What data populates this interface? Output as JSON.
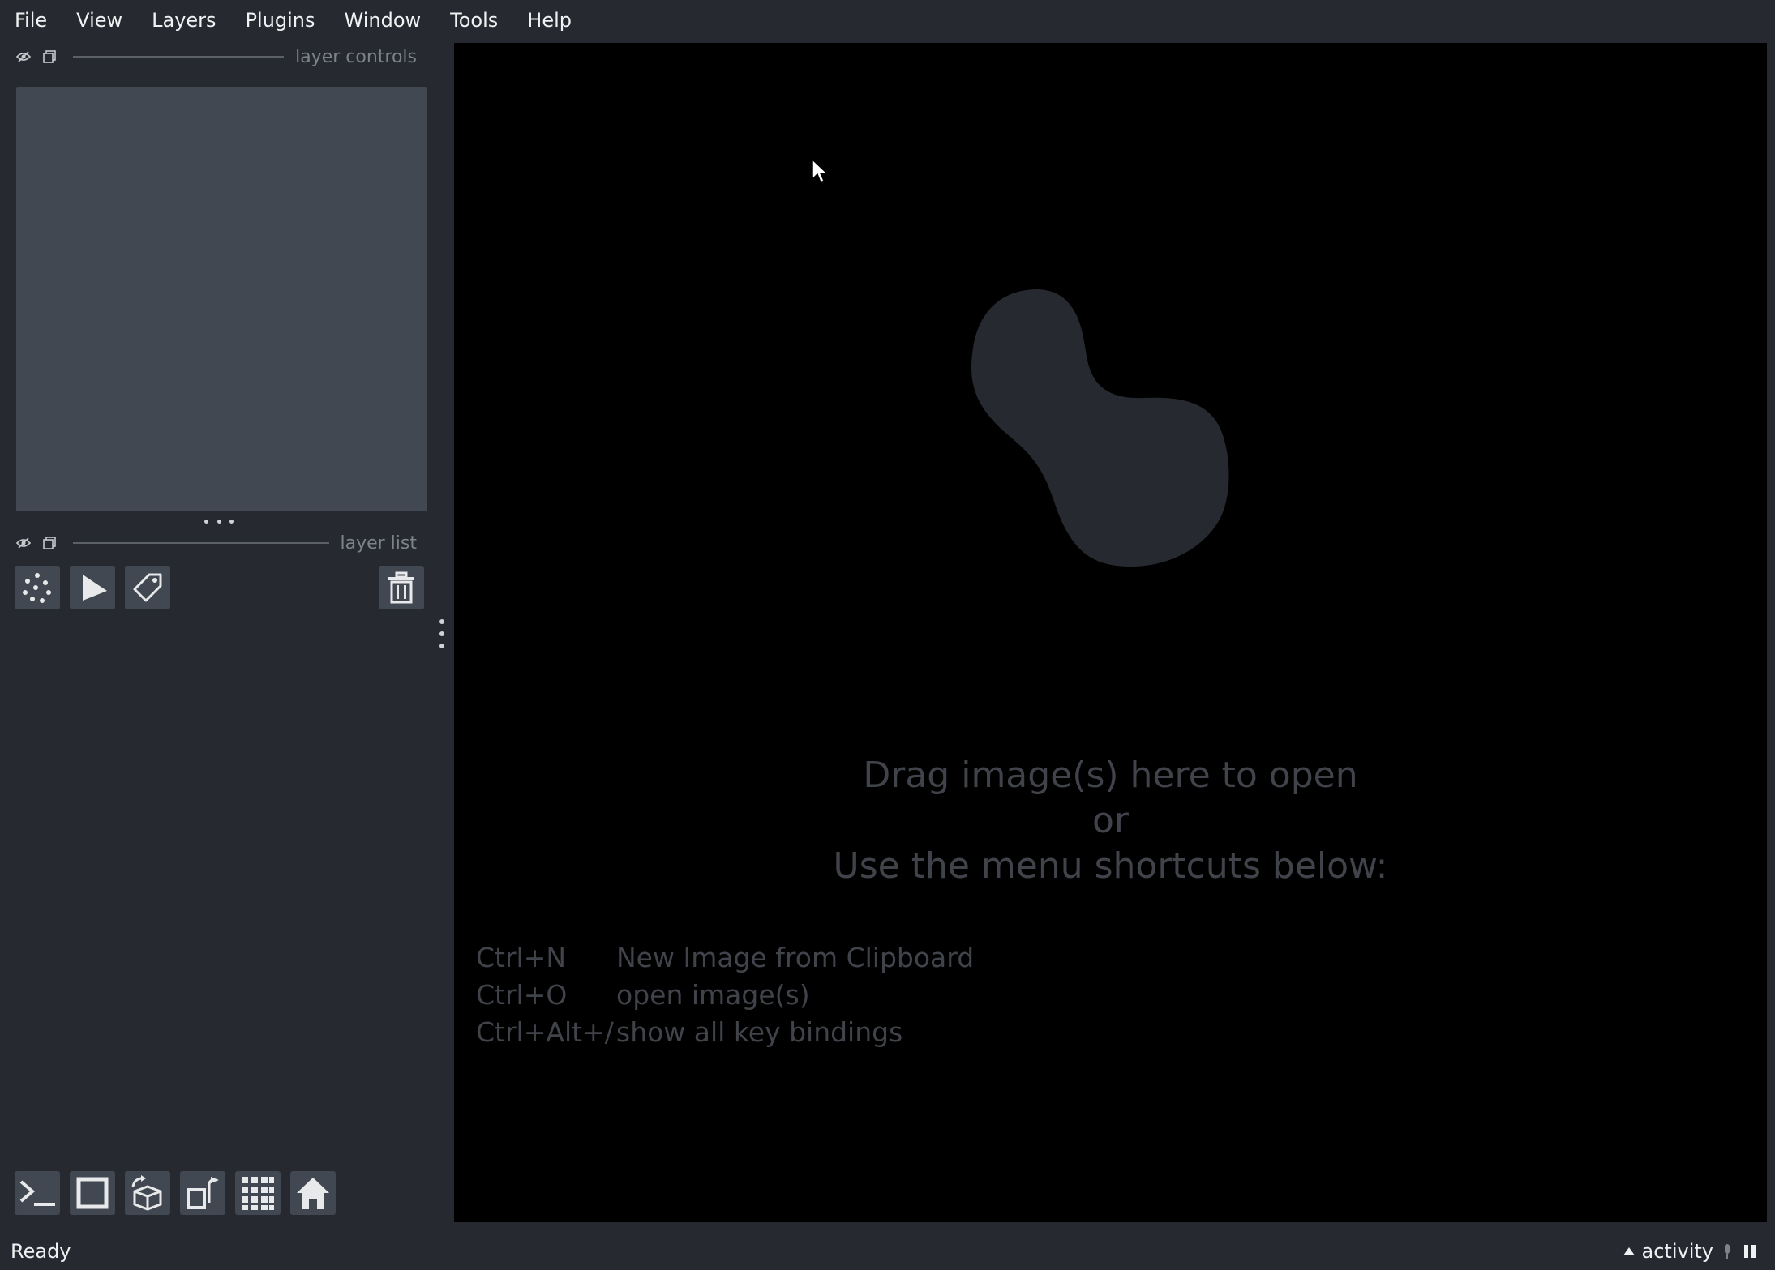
{
  "menubar": {
    "items": [
      "File",
      "View",
      "Layers",
      "Plugins",
      "Window",
      "Tools",
      "Help"
    ]
  },
  "layer_controls": {
    "title": "layer controls"
  },
  "layer_list": {
    "title": "layer list",
    "tools": [
      {
        "name": "new-points-layer",
        "icon": "points-icon"
      },
      {
        "name": "new-shapes-layer",
        "icon": "shapes-icon"
      },
      {
        "name": "new-labels-layer",
        "icon": "labels-icon"
      }
    ],
    "delete_icon": "trash-icon"
  },
  "bottom_buttons": [
    "console-icon",
    "ndisplay-square-icon",
    "roll-3d-icon",
    "transpose-icon",
    "grid-icon",
    "home-icon"
  ],
  "canvas": {
    "welcome_lines": [
      "Drag image(s) here to open",
      "or",
      "Use the menu shortcuts below:"
    ],
    "shortcuts": [
      {
        "key": "Ctrl+N",
        "action": "New Image from Clipboard"
      },
      {
        "key": "Ctrl+O",
        "action": "open image(s)"
      },
      {
        "key": "Ctrl+Alt+/",
        "action": "show all key bindings"
      }
    ]
  },
  "status": {
    "text": "Ready",
    "activity_label": "activity"
  },
  "colors": {
    "background": "#262930",
    "panel": "#414851",
    "canvas": "#000000",
    "logo": "#262930",
    "text_muted": "#40434a"
  }
}
